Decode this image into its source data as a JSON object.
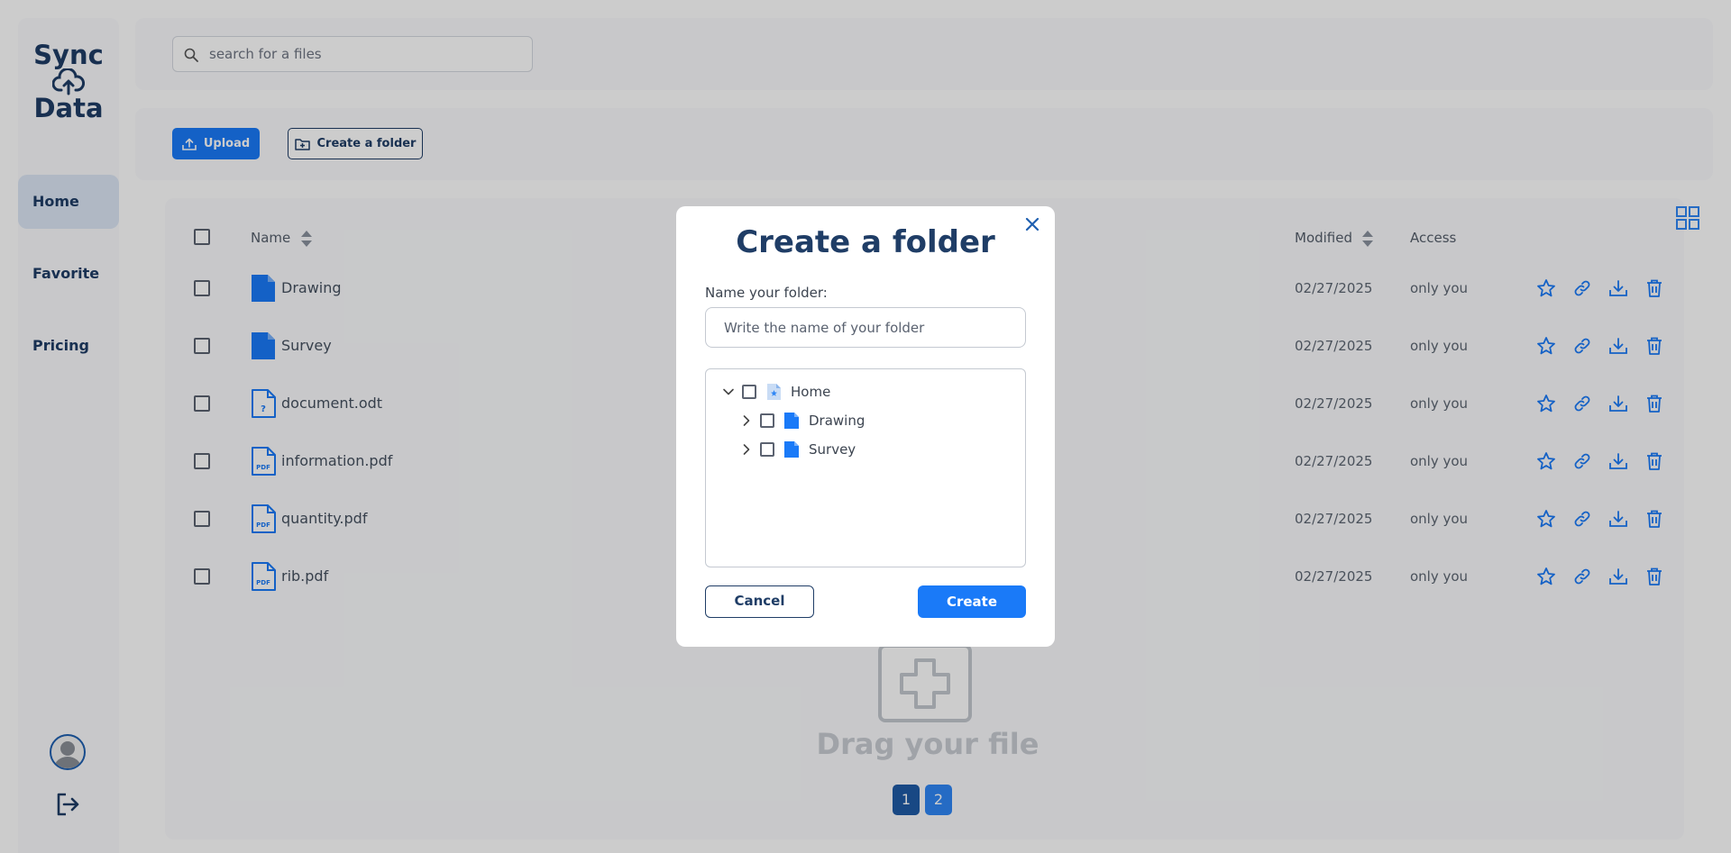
{
  "app": {
    "logo_line1": "Sync",
    "logo_line2": "Data"
  },
  "sidebar": {
    "items": [
      {
        "label": "Home",
        "active": true
      },
      {
        "label": "Favorite",
        "active": false
      },
      {
        "label": "Pricing",
        "active": false
      }
    ]
  },
  "search": {
    "placeholder": "search for a files"
  },
  "toolbar": {
    "upload_label": "Upload",
    "create_folder_label": "Create a folder"
  },
  "table": {
    "headers": {
      "name": "Name",
      "modified": "Modified",
      "access": "Access"
    },
    "rows": [
      {
        "name": "Drawing",
        "type": "folder",
        "modified": "02/27/2025",
        "access": "only you"
      },
      {
        "name": "Survey",
        "type": "folder",
        "modified": "02/27/2025",
        "access": "only you"
      },
      {
        "name": "document.odt",
        "type": "unknown",
        "modified": "02/27/2025",
        "access": "only you"
      },
      {
        "name": "information.pdf",
        "type": "pdf",
        "modified": "02/27/2025",
        "access": "only you"
      },
      {
        "name": "quantity.pdf",
        "type": "pdf",
        "modified": "02/27/2025",
        "access": "only you"
      },
      {
        "name": "rib.pdf",
        "type": "pdf",
        "modified": "02/27/2025",
        "access": "only you"
      }
    ]
  },
  "drop_zone": {
    "label": "Drag your file"
  },
  "pagination": {
    "pages": [
      "1",
      "2"
    ],
    "current": "1"
  },
  "modal": {
    "title": "Create a folder",
    "name_label": "Name your folder:",
    "name_placeholder": "Write the name of your folder",
    "tree": {
      "root": "Home",
      "children": [
        "Drawing",
        "Survey"
      ]
    },
    "cancel_label": "Cancel",
    "create_label": "Create"
  },
  "colors": {
    "accent": "#1a7af8",
    "navy": "#1f3d66",
    "overlay": "rgba(0,0,0,0.2)"
  }
}
